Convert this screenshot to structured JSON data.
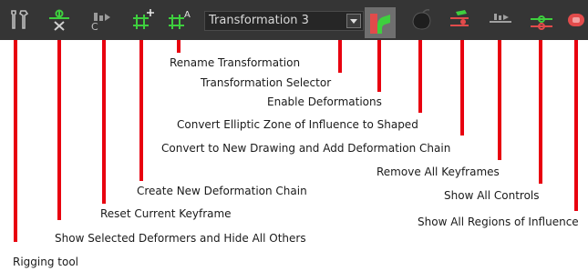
{
  "toolbar": {
    "buttons": [
      {
        "icon": "rigging-tool-icon",
        "label": "Rigging tool"
      },
      {
        "icon": "show-selected-deformers-icon",
        "label": "Show Selected Deformers and Hide All Others"
      },
      {
        "icon": "reset-keyframe-icon",
        "label": "Reset Current Keyframe"
      },
      {
        "icon": "create-deformation-chain-icon",
        "label": "Create New Deformation Chain"
      },
      {
        "icon": "rename-transformation-icon",
        "label": "Rename Transformation"
      },
      {
        "icon": "transformation-selector-icon",
        "label": "Transformation Selector"
      },
      {
        "icon": "enable-deformations-icon",
        "label": "Enable Deformations"
      },
      {
        "icon": "convert-elliptic-zone-icon",
        "label": "Convert Elliptic Zone of Influence to Shaped"
      },
      {
        "icon": "convert-to-drawing-icon",
        "label": "Convert to New Drawing and Add Deformation Chain"
      },
      {
        "icon": "remove-keyframes-icon",
        "label": "Remove All Keyframes"
      },
      {
        "icon": "show-all-controls-icon",
        "label": "Show All Controls"
      },
      {
        "icon": "show-regions-icon",
        "label": "Show All Regions of Influence"
      }
    ],
    "selector_value": "Transformation 3"
  },
  "colors": {
    "toolbar_bg": "#353535",
    "callout_red": "#e8000f",
    "accent_green": "#3ecf3e",
    "accent_red": "#e24b4b"
  }
}
